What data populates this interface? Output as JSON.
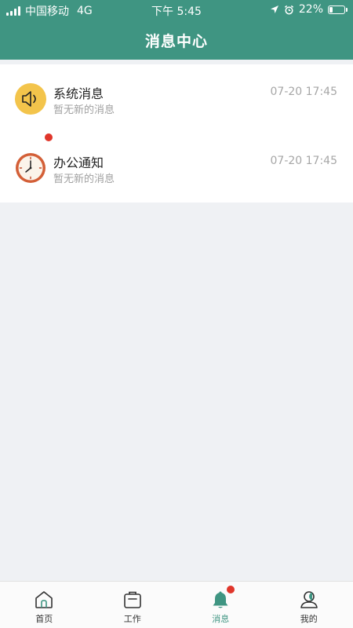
{
  "status_bar": {
    "carrier": "中国移动",
    "network": "4G",
    "time": "下午 5:45",
    "battery_percent": "22%",
    "battery_level": 0.22
  },
  "header": {
    "title": "消息中心"
  },
  "messages": [
    {
      "title": "系统消息",
      "subtitle": "暂无新的消息",
      "time": "07-20 17:45",
      "icon": "speaker-icon",
      "unread": false
    },
    {
      "title": "办公通知",
      "subtitle": "暂无新的消息",
      "time": "07-20 17:45",
      "icon": "clock-icon",
      "unread": true
    }
  ],
  "tabbar": {
    "items": [
      {
        "label": "首页",
        "icon": "home-icon",
        "active": false
      },
      {
        "label": "工作",
        "icon": "briefcase-icon",
        "active": false
      },
      {
        "label": "消息",
        "icon": "bell-icon",
        "active": true,
        "badge": true
      },
      {
        "label": "我的",
        "icon": "profile-icon",
        "active": false
      }
    ]
  },
  "colors": {
    "primary": "#3f9582",
    "badge_red": "#e0362b",
    "background": "#eff1f4",
    "speaker_icon_bg": "#f3c44b",
    "clock_icon_ring": "#d35f37"
  }
}
